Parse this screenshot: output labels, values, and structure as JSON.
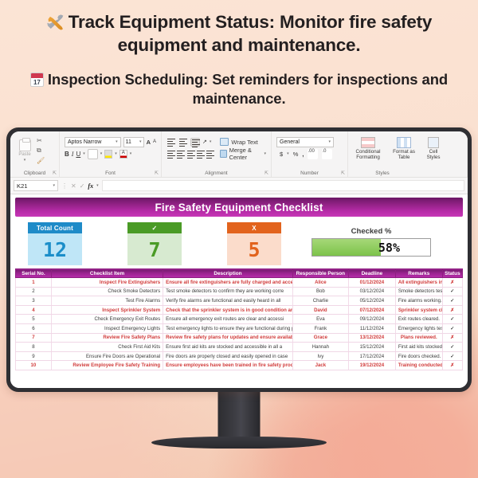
{
  "headlines": {
    "line1_icon": "tools-icon",
    "line1": "Track Equipment Status: Monitor fire safety equipment and maintenance.",
    "line2_icon": "calendar-icon",
    "line2_day": "17",
    "line2": "Inspection Scheduling: Set reminders for inspections and maintenance."
  },
  "ribbon": {
    "groups": [
      {
        "name": "Clipboard",
        "label": "Clipboard"
      },
      {
        "name": "Font",
        "label": "Font"
      },
      {
        "name": "Alignment",
        "label": "Alignment"
      },
      {
        "name": "Number",
        "label": "Number"
      },
      {
        "name": "Styles",
        "label": "Styles"
      }
    ],
    "paste_label": "Paste",
    "font_name": "Aptos Narrow",
    "font_size": "11",
    "grow_font": "A",
    "shrink_font": "A",
    "bold": "B",
    "italic": "I",
    "underline": "U",
    "wrap_text": "Wrap Text",
    "merge_center": "Merge & Center",
    "number_format": "General",
    "currency": "$",
    "percent": "%",
    "comma": "(,)",
    "conditional_formatting": "Conditional Formatting",
    "format_as_table": "Format as Table",
    "cell_styles": "Cell Styles"
  },
  "formula_bar": {
    "name_box": "K21",
    "cancel": "✕",
    "enter": "✓",
    "fx": "fx",
    "formula_value": ""
  },
  "sheet": {
    "title": "Fire Safety Equipment Checklist",
    "kpis": [
      {
        "name": "total-count",
        "caption": "Total Count",
        "value": "12",
        "color": "#1e8bc8"
      },
      {
        "name": "checked-count",
        "caption": "✓",
        "value": "7",
        "color": "#4a9b26"
      },
      {
        "name": "unchecked-count",
        "caption": "X",
        "value": "5",
        "color": "#e2631d"
      }
    ],
    "percent_card": {
      "label": "Checked %",
      "value": "58%",
      "fill_percent": 58,
      "fill_color": "#7cc34a"
    },
    "table": {
      "columns": [
        "Serial No.",
        "Checklist Item",
        "Description",
        "Responsible Person",
        "Deadline",
        "Remarks",
        "Status"
      ],
      "rows": [
        {
          "sn": "1",
          "item": "Inspect Fire Extinguishers",
          "desc": "Ensure all fire extinguishers are fully charged and acces",
          "person": "Alice",
          "deadline": "01/12/2024",
          "remarks": "All extinguishers inspected.",
          "status": "✗",
          "highlight": true
        },
        {
          "sn": "2",
          "item": "Check Smoke Detectors",
          "desc": "Test smoke detectors to confirm they are working corre",
          "person": "Bob",
          "deadline": "03/12/2024",
          "remarks": "Smoke detectors tested.",
          "status": "✓",
          "highlight": false
        },
        {
          "sn": "3",
          "item": "Test Fire Alarms",
          "desc": "Verify fire alarms are functional and easily heard in all",
          "person": "Charlie",
          "deadline": "05/12/2024",
          "remarks": "Fire alarms working.",
          "status": "✓",
          "highlight": false
        },
        {
          "sn": "4",
          "item": "Inspect Sprinkler System",
          "desc": "Check that the sprinkler system is in good condition and op",
          "person": "David",
          "deadline": "07/12/2024",
          "remarks": "Sprinkler system checked.",
          "status": "✗",
          "highlight": true
        },
        {
          "sn": "5",
          "item": "Check Emergency Exit Routes",
          "desc": "Ensure all emergency exit routes are clear and accessi",
          "person": "Eva",
          "deadline": "09/12/2024",
          "remarks": "Exit routes cleared.",
          "status": "✓",
          "highlight": false
        },
        {
          "sn": "6",
          "item": "Inspect Emergency Lights",
          "desc": "Test emergency lights to ensure they are functional during pow",
          "person": "Frank",
          "deadline": "11/12/2024",
          "remarks": "Emergency lights tested.",
          "status": "✓",
          "highlight": false
        },
        {
          "sn": "7",
          "item": "Review Fire Safety Plans",
          "desc": "Review fire safety plans for updates and ensure availabilit",
          "person": "Grace",
          "deadline": "13/12/2024",
          "remarks": "Plans reviewed.",
          "status": "✗",
          "highlight": true
        },
        {
          "sn": "8",
          "item": "Check First Aid Kits",
          "desc": "Ensure first aid kits are stocked and accessible in all a",
          "person": "Hannah",
          "deadline": "15/12/2024",
          "remarks": "First aid kits stocked.",
          "status": "✓",
          "highlight": false
        },
        {
          "sn": "9",
          "item": "Ensure Fire Doors are Operational",
          "desc": "Fire doors are properly closed and easily opened in case",
          "person": "Ivy",
          "deadline": "17/12/2024",
          "remarks": "Fire doors checked.",
          "status": "✓",
          "highlight": false
        },
        {
          "sn": "10",
          "item": "Review Employee Fire Safety Training",
          "desc": "Ensure employees have been trained in fire safety proce",
          "person": "Jack",
          "deadline": "19/12/2024",
          "remarks": "Training conducted.",
          "status": "✗",
          "highlight": true
        }
      ]
    }
  }
}
